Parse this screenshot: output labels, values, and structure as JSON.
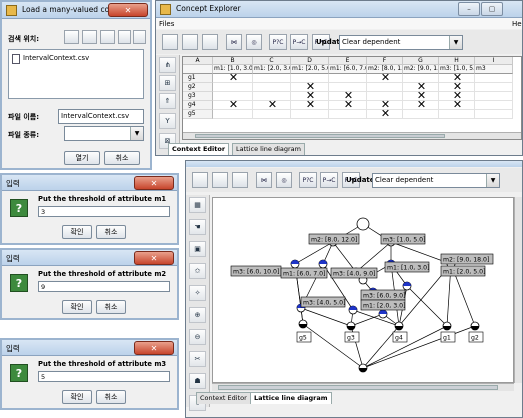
{
  "load_dialog": {
    "title": "Load a many-valued context",
    "close": "✕",
    "look_in_label": "검색 위치:",
    "file_item": "IntervalContext.csv",
    "file_name_label": "파일 이름:",
    "file_name_value": "IntervalContext.csv",
    "file_type_label": "파일 종류:",
    "file_type_value": "",
    "open_button": "열기",
    "cancel_button": "취소"
  },
  "explorer_window": {
    "title": "Concept Explorer",
    "menu_files": "Files",
    "menu_help": "Hel",
    "update_label": "Update:",
    "update_value": "Clear dependent",
    "column_letters": [
      "A",
      "B",
      "C",
      "D",
      "E",
      "F",
      "G",
      "H",
      "I"
    ],
    "column_attrs": [
      "",
      "m1: [1.0, 3.0]",
      "m1: [2.0, 3.0]",
      "m1: [2.0, 5.0]",
      "m1: [6.0, 7.0]",
      "m2: [8.0, 1...",
      "m2: [9.0, 1...",
      "m3: [1.0, 5.0]",
      "m3"
    ],
    "rows": [
      "g1",
      "g2",
      "g3",
      "g4",
      "g5"
    ],
    "crosses": [
      {
        "row": 0,
        "col": 1
      },
      {
        "row": 0,
        "col": 5
      },
      {
        "row": 0,
        "col": 7
      },
      {
        "row": 1,
        "col": 3
      },
      {
        "row": 1,
        "col": 6
      },
      {
        "row": 1,
        "col": 7
      },
      {
        "row": 2,
        "col": 3
      },
      {
        "row": 2,
        "col": 4
      },
      {
        "row": 2,
        "col": 6
      },
      {
        "row": 2,
        "col": 7
      },
      {
        "row": 3,
        "col": 1
      },
      {
        "row": 3,
        "col": 2
      },
      {
        "row": 3,
        "col": 3
      },
      {
        "row": 3,
        "col": 4
      },
      {
        "row": 3,
        "col": 5
      },
      {
        "row": 3,
        "col": 6
      },
      {
        "row": 3,
        "col": 7
      },
      {
        "row": 4,
        "col": 5
      }
    ],
    "cross_glyph": "✕",
    "tab_context_editor": "Context Editor",
    "tab_lattice": "Lattice line diagram"
  },
  "lattice_window": {
    "update_label": "Update:",
    "update_value": "Clear dependent",
    "tab_context_editor": "Context Editor",
    "tab_lattice": "Lattice line diagram",
    "attribute_labels": [
      "m2: [8.0, 12.0]",
      "m3: [1.0, 5.0]",
      "m1: [1.0, 3.0]",
      "m2: [9.0, 18.0]",
      "m1: [2.0, 5.0]",
      "m3: [6.0, 10.0]",
      "m1: [6.0, 7.0]",
      "m3: [4.0, 9.0]",
      "m3: [6.0, 9.0]",
      "m1: [2.0, 3.0]",
      "m3: [4.0, 5.0]"
    ],
    "object_labels": [
      "g5",
      "g3",
      "g4",
      "g1",
      "g2"
    ]
  },
  "threshold_dialogs": [
    {
      "title": "입력",
      "prompt": "Put the threshold of attribute m1",
      "value": "3",
      "ok": "확인",
      "cancel": "취소"
    },
    {
      "title": "입력",
      "prompt": "Put the threshold of attribute m2",
      "value": "9",
      "ok": "확인",
      "cancel": "취소"
    },
    {
      "title": "입력",
      "prompt": "Put the threshold of attribute m3",
      "value": "5",
      "ok": "확인",
      "cancel": "취소"
    }
  ],
  "toolbar_icons": [
    "new-icon",
    "open-icon",
    "save-icon",
    "lattice-icon",
    "zoom-lattice-icon",
    "p-question-icon",
    "p-arrow-c-icon",
    "p-arrow-c-up-icon"
  ],
  "toolbar_labels": [
    "",
    "",
    "",
    "⋈",
    "◎",
    "P?C",
    "P→C",
    "P↗C"
  ],
  "colors": {
    "accent": "#2a3fd6",
    "node_fill": "#1f35c8",
    "title_bar": "#c8dcf0",
    "close": "#c7452c"
  }
}
